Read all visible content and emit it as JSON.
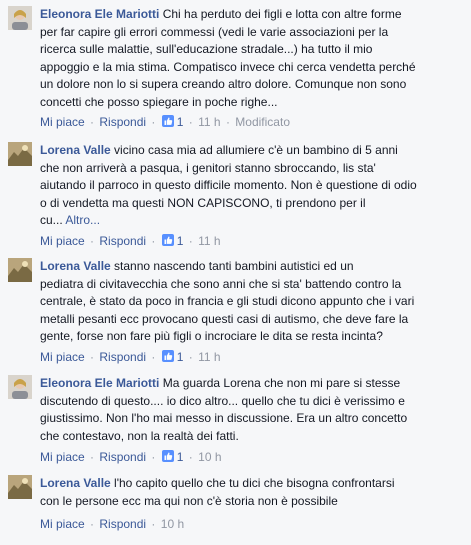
{
  "ui": {
    "like_label": "Mi piace",
    "reply_label": "Rispondi",
    "separator": "·",
    "more_link": "Altro..."
  },
  "comments": [
    {
      "author": "Eleonora Ele Mariotti",
      "lines": [
        "Chi ha perduto dei figli e lotta con altre forme",
        "per far capire gli errori commessi (vedi le varie associazioni per la",
        "ricerca sulle malattie, sull'educazione stradale...) ha tutto il mio",
        "appoggio e la mia stima. Compatisco invece chi cerca vendetta perché",
        "un dolore non lo si supera creando altro dolore. Comunque non sono",
        "concetti che posso spiegare in poche righe..."
      ],
      "likes": "1",
      "time": "11 h",
      "edited": "Modificato"
    },
    {
      "author": "Lorena Valle",
      "lines": [
        "vicino casa mia ad allumiere c'è un bambino di 5 anni",
        "che non arriverà a pasqua, i genitori stanno sbroccando, lis sta'",
        "aiutando il parroco in questo difficile momento. Non è questione di odio",
        "o di vendetta ma questi NON CAPISCONO, ti prendono per il",
        "cu..."
      ],
      "likes": "1",
      "time": "11 h"
    },
    {
      "author": "Lorena Valle",
      "lines": [
        "stanno nascendo tanti bambini autistici ed un",
        "pediatra di civitavecchia che sono anni che si sta' battendo contro la",
        "centrale, è stato da poco in francia e gli studi dicono appunto che i vari",
        "metalli pesanti ecc provocano questi casi di autismo, che deve fare la",
        "gente, forse non fare più figli o incrociare le dita se resta incinta?"
      ],
      "likes": "1",
      "time": "11 h"
    },
    {
      "author": "Eleonora Ele Mariotti",
      "lines": [
        "Ma guarda Lorena che non mi pare si stesse",
        "discutendo di questo.... io dico altro... quello che tu dici è verissimo e",
        "giustissimo. Non l'ho mai messo in discussione. Era un altro concetto",
        "che contestavo, non la realtà dei fatti."
      ],
      "likes": "1",
      "time": "10 h"
    },
    {
      "author": "Lorena Valle",
      "lines": [
        "l'ho capito quello che tu dici che bisogna confrontarsi",
        "con le persone ecc ma qui non c'è storia non è possibile"
      ],
      "time": "10 h"
    }
  ]
}
